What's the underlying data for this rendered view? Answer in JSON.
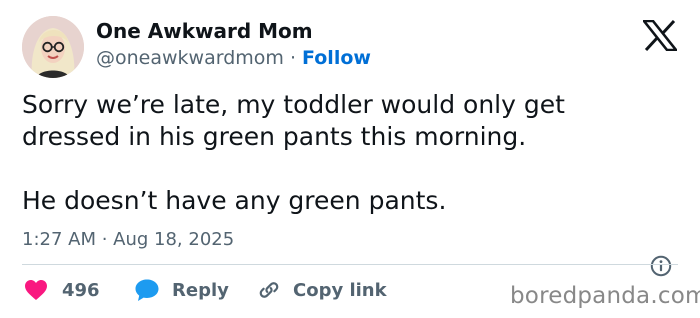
{
  "author": {
    "display_name": "One Awkward Mom",
    "handle": "@oneawkwardmom",
    "separator": "·",
    "follow_label": "Follow"
  },
  "tweet": {
    "line1": "Sorry we’re late, my toddler would only get",
    "line2": "dressed in his green pants this morning.",
    "line3": "He doesn’t have any green pants.",
    "timestamp": "1:27 AM · Aug 18, 2025"
  },
  "actions": {
    "like_count": "496",
    "reply_label": "Reply",
    "copy_link_label": "Copy link"
  },
  "watermark": "boredpanda.com",
  "colors": {
    "text": "#0f1419",
    "secondary": "#536471",
    "follow": "#006fd6",
    "like": "#f91880",
    "reply": "#1d9bf0",
    "divider": "#cfd9de",
    "watermark": "#888888"
  },
  "icons": [
    "avatar",
    "x-logo-icon",
    "info-icon",
    "heart-icon",
    "reply-bubble-icon",
    "link-icon"
  ]
}
